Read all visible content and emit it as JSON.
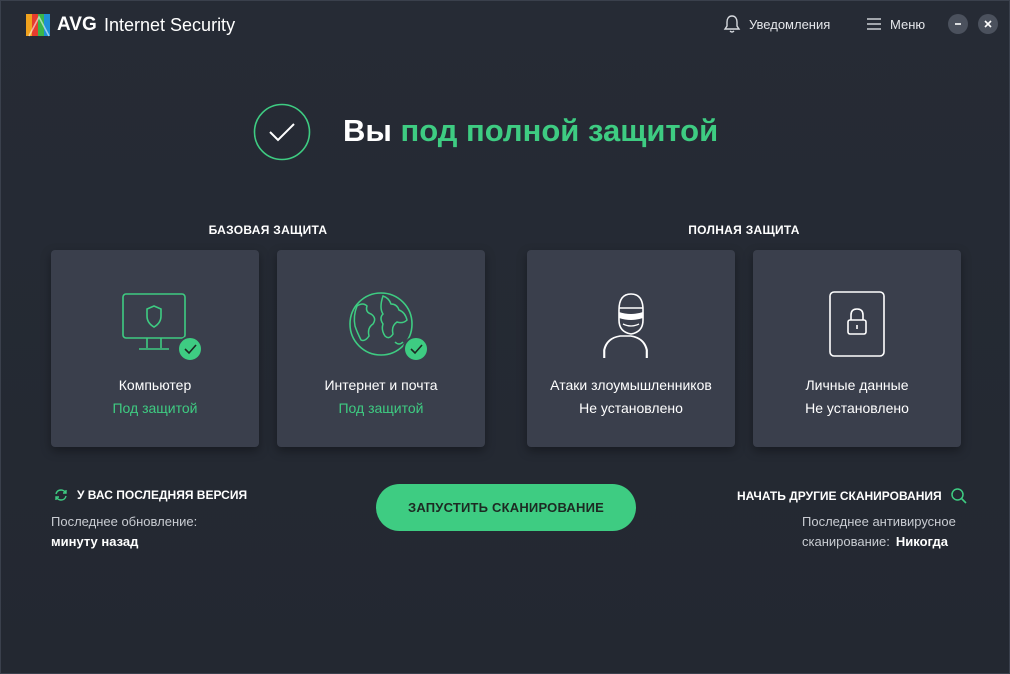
{
  "app": {
    "brand": "AVG",
    "product": "Internet Security",
    "notifications_label": "Уведомления",
    "menu_label": "Меню"
  },
  "hero": {
    "title_prefix": "Вы",
    "title_highlight": "под полной защитой"
  },
  "sections": {
    "basic": "БАЗОВАЯ ЗАЩИТА",
    "full": "ПОЛНАЯ ЗАЩИТА"
  },
  "cards": [
    {
      "name": "Компьютер",
      "status": "Под защитой",
      "icon": "monitor-shield-icon",
      "protected": true
    },
    {
      "name": "Интернет и почта",
      "status": "Под защитой",
      "icon": "globe-icon",
      "protected": true
    },
    {
      "name": "Атаки злоумышленников",
      "status": "Не установлено",
      "icon": "hacker-icon",
      "protected": false
    },
    {
      "name": "Личные данные",
      "status": "Не установлено",
      "icon": "lock-icon",
      "protected": false
    }
  ],
  "update": {
    "header": "У ВАС ПОСЛЕДНЯЯ ВЕРСИЯ",
    "label": "Последнее обновление:",
    "value": "минуту назад"
  },
  "scan_button": "ЗАПУСТИТЬ СКАНИРОВАНИЕ",
  "other_scans": {
    "header": "НАЧАТЬ ДРУГИЕ СКАНИРОВАНИЯ",
    "label_line1": "Последнее антивирусное",
    "label_line2": "сканирование:",
    "value": "Никогда"
  },
  "colors": {
    "background": "#252a34",
    "card": "#3a3f4c",
    "accent_green": "#3ecc82"
  }
}
